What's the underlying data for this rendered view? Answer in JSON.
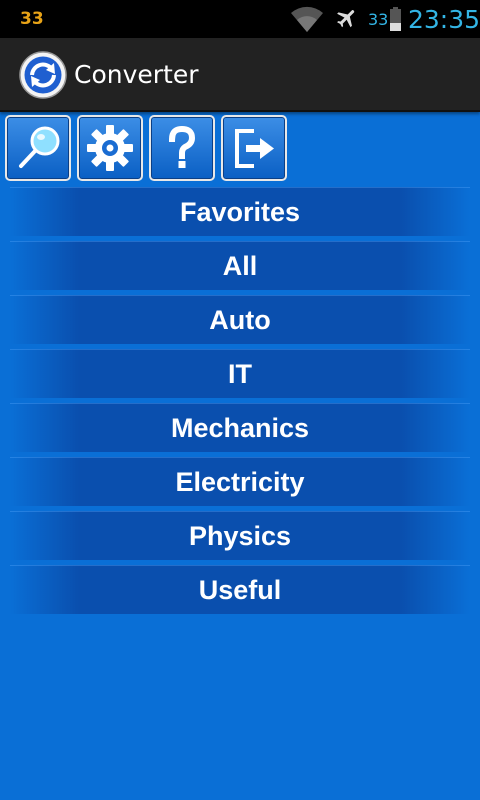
{
  "status_bar": {
    "notification": "33",
    "battery_level": "33",
    "time": "23:35",
    "icons": [
      "wifi-icon",
      "airplane-mode-icon",
      "battery-icon"
    ]
  },
  "action_bar": {
    "title": "Converter",
    "icon": "converter-app-icon"
  },
  "toolbar": {
    "buttons": [
      {
        "name": "search",
        "icon": "magnifier-icon"
      },
      {
        "name": "settings",
        "icon": "gear-icon"
      },
      {
        "name": "help",
        "icon": "question-mark-icon"
      },
      {
        "name": "exit",
        "icon": "exit-icon"
      }
    ]
  },
  "categories": [
    "Favorites",
    "All",
    "Auto",
    "IT",
    "Mechanics",
    "Electricity",
    "Physics",
    "Useful"
  ],
  "colors": {
    "background": "#0a6fd6",
    "status_accent": "#33b5e5",
    "notification_accent": "#e8a317",
    "action_bar": "#222222",
    "list_item": "#0a4fae"
  }
}
